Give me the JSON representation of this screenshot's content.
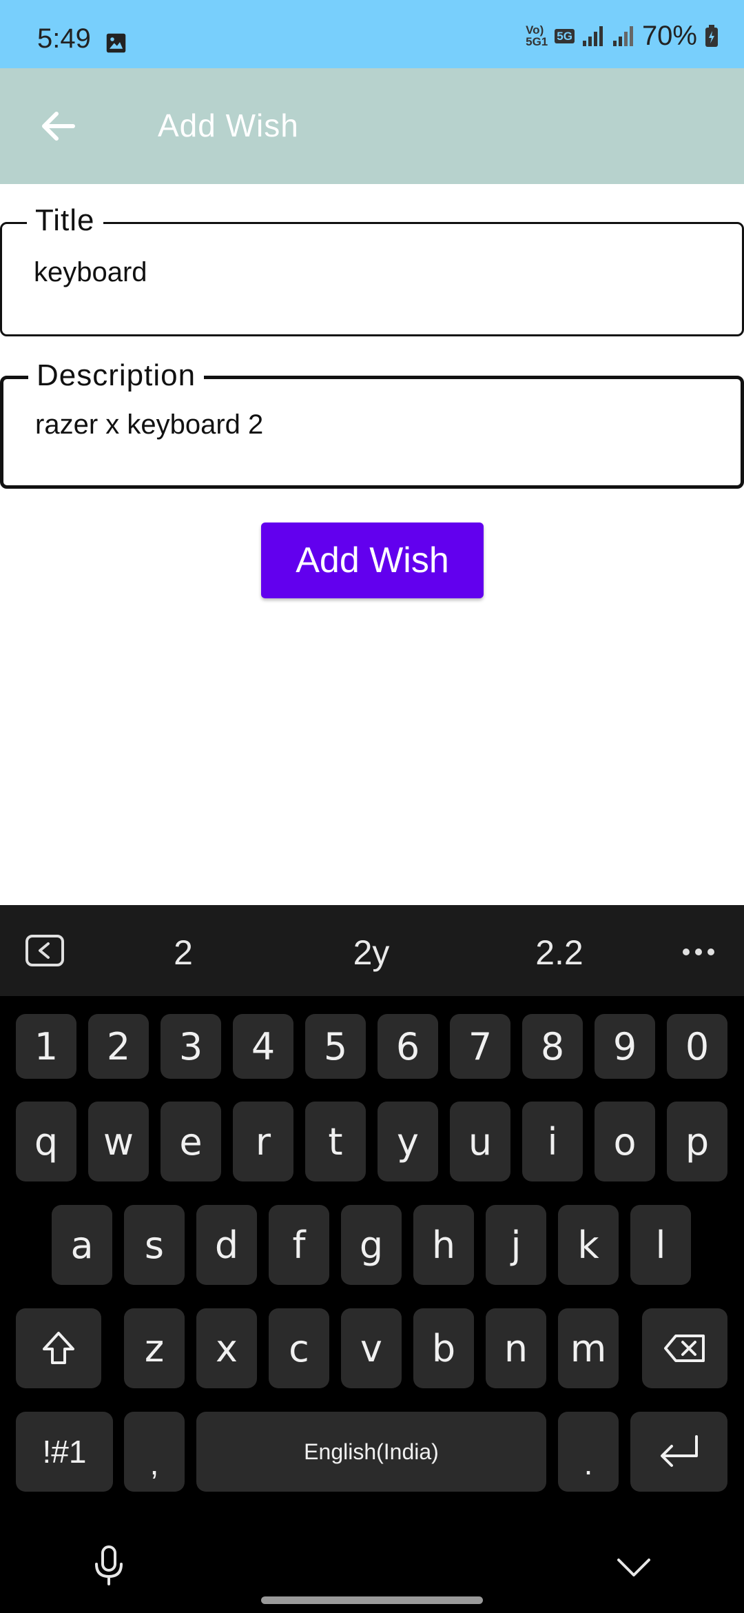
{
  "status_bar": {
    "time": "5:49",
    "volte": "Vo))\n5G1",
    "net": "5G",
    "battery": "70%",
    "icons": [
      "gallery-icon",
      "signal-icon",
      "signal-icon",
      "battery-icon"
    ]
  },
  "app_bar": {
    "title": "Add Wish",
    "back_icon": "arrow-left-icon",
    "background": "#b7d2cd"
  },
  "form": {
    "title_label": "Title",
    "title_value": "keyboard",
    "description_label": "Description",
    "description_value": "razer x keyboard 2",
    "submit_label": "Add Wish",
    "submit_color": "#6200ee"
  },
  "keyboard": {
    "suggestions": [
      "2",
      "2y",
      "2.2"
    ],
    "number_row": [
      "1",
      "2",
      "3",
      "4",
      "5",
      "6",
      "7",
      "8",
      "9",
      "0"
    ],
    "row1": [
      "q",
      "w",
      "e",
      "r",
      "t",
      "y",
      "u",
      "i",
      "o",
      "p"
    ],
    "row2": [
      "a",
      "s",
      "d",
      "f",
      "g",
      "h",
      "j",
      "k",
      "l"
    ],
    "row3": [
      "z",
      "x",
      "c",
      "v",
      "b",
      "n",
      "m"
    ],
    "symbols_label": "!#1",
    "comma_label": ",",
    "space_label": "English(India)",
    "period_label": "."
  }
}
